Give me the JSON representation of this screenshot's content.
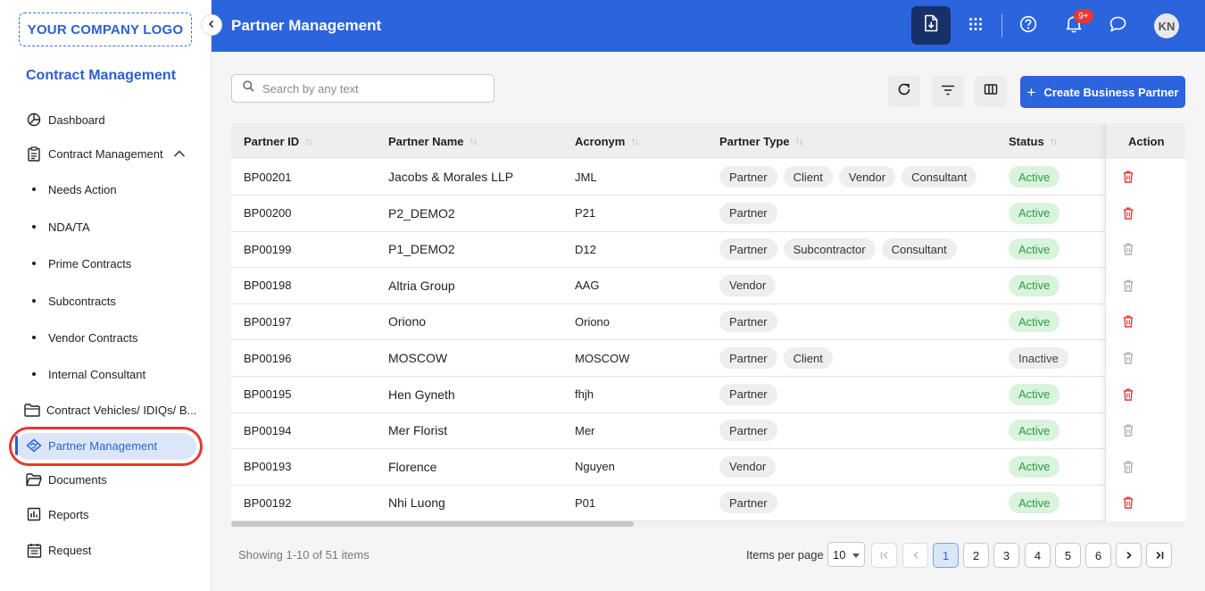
{
  "sidebar": {
    "logo": "YOUR COMPANY LOGO",
    "app_title": "Contract Management",
    "items": {
      "dashboard": "Dashboard",
      "contract_management": "Contract Management",
      "needs_action": "Needs Action",
      "nda_ta": "NDA/TA",
      "prime_contracts": "Prime Contracts",
      "subcontracts": "Subcontracts",
      "vendor_contracts": "Vendor Contracts",
      "internal_consultant": "Internal Consultant",
      "contract_vehicles": "Contract Vehicles/ IDIQs/ B...",
      "partner_management": "Partner Management",
      "documents": "Documents",
      "reports": "Reports",
      "request": "Request"
    },
    "active_item": "partner_management"
  },
  "header": {
    "title": "Partner Management",
    "notification_badge": "9+",
    "avatar_initials": "KN"
  },
  "toolbar": {
    "search_placeholder": "Search by any text",
    "create_label": "Create Business Partner"
  },
  "table": {
    "columns": {
      "partner_id": "Partner ID",
      "partner_name": "Partner Name",
      "acronym": "Acronym",
      "partner_type": "Partner Type",
      "status": "Status",
      "action": "Action"
    },
    "rows": [
      {
        "id": "BP00201",
        "name": "Jacobs & Morales LLP",
        "acronym": "JML",
        "types": [
          "Partner",
          "Client",
          "Vendor",
          "Consultant"
        ],
        "status": "Active",
        "delete_enabled": true
      },
      {
        "id": "BP00200",
        "name": "P2_DEMO2",
        "acronym": "P21",
        "types": [
          "Partner"
        ],
        "status": "Active",
        "delete_enabled": true
      },
      {
        "id": "BP00199",
        "name": "P1_DEMO2",
        "acronym": "D12",
        "types": [
          "Partner",
          "Subcontractor",
          "Consultant"
        ],
        "status": "Active",
        "delete_enabled": false
      },
      {
        "id": "BP00198",
        "name": "Altria Group",
        "acronym": "AAG",
        "types": [
          "Vendor"
        ],
        "status": "Active",
        "delete_enabled": false
      },
      {
        "id": "BP00197",
        "name": "Oriono",
        "acronym": "Oriono",
        "types": [
          "Partner"
        ],
        "status": "Active",
        "delete_enabled": true
      },
      {
        "id": "BP00196",
        "name": "MOSCOW",
        "acronym": "MOSCOW",
        "types": [
          "Partner",
          "Client"
        ],
        "status": "Inactive",
        "delete_enabled": false
      },
      {
        "id": "BP00195",
        "name": "Hen Gyneth",
        "acronym": "fhjh",
        "types": [
          "Partner"
        ],
        "status": "Active",
        "delete_enabled": true
      },
      {
        "id": "BP00194",
        "name": "Mer Florist",
        "acronym": "Mer",
        "types": [
          "Partner"
        ],
        "status": "Active",
        "delete_enabled": false
      },
      {
        "id": "BP00193",
        "name": "Florence",
        "acronym": "Nguyen",
        "types": [
          "Vendor"
        ],
        "status": "Active",
        "delete_enabled": false
      },
      {
        "id": "BP00192",
        "name": "Nhi Luong",
        "acronym": "P01",
        "types": [
          "Partner"
        ],
        "status": "Active",
        "delete_enabled": true
      }
    ]
  },
  "footer": {
    "showing": "Showing 1-10 of 51 items",
    "items_per_page_label": "Items per page",
    "items_per_page_value": "10",
    "pages": [
      "1",
      "2",
      "3",
      "4",
      "5",
      "6"
    ],
    "current_page": "1"
  },
  "colors": {
    "primary": "#2b64dc",
    "header_action_bg": "#17306a",
    "active_status_bg": "#d9f3dc",
    "active_status_text": "#2e9b45",
    "delete_red": "#e53935",
    "highlight_ring": "#e53935"
  },
  "icons": {
    "collapse": "chevron-left-icon",
    "header": [
      "download-file-icon",
      "apps-grid-icon",
      "help-icon",
      "bell-icon",
      "chat-icon"
    ],
    "toolbar": [
      "refresh-icon",
      "filter-icon",
      "columns-icon"
    ],
    "row_action": "trash-icon"
  }
}
